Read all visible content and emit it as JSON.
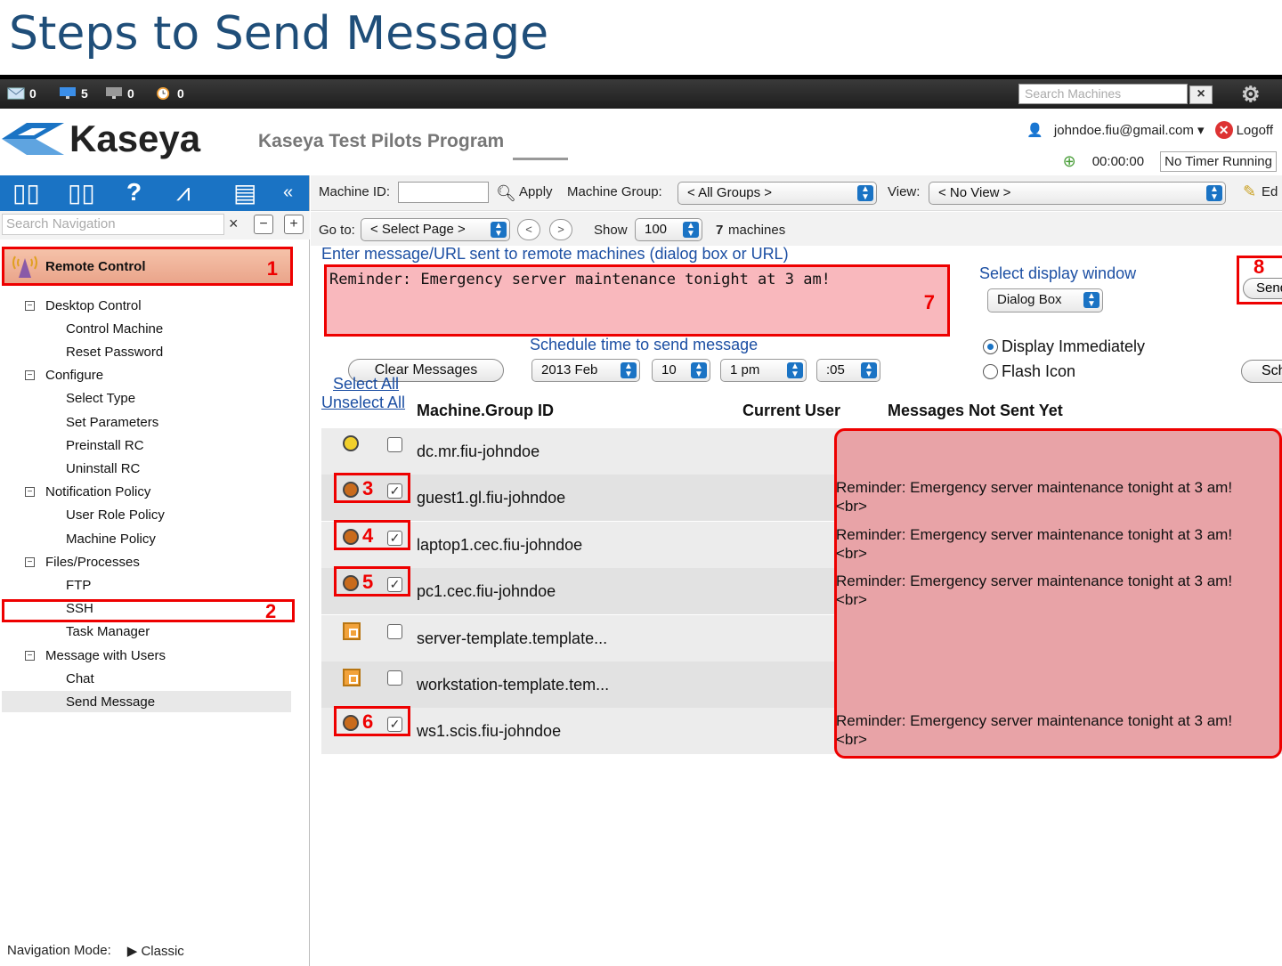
{
  "slide_title": "Steps to Send Message",
  "topbar": {
    "counts": [
      "0",
      "5",
      "0",
      "0"
    ],
    "search_placeholder": "Search Machines",
    "search_clear": "×"
  },
  "header": {
    "logo": "Kaseya",
    "program": "Kaseya Test Pilots Program",
    "user": "johndoe.fiu@gmail.com ▾",
    "logoff": "Logoff",
    "timer": "00:00:00",
    "timer_status": "No Timer Running"
  },
  "nav": {
    "search_placeholder": "Search Navigation",
    "search_clear": "×",
    "collapse": "−",
    "expand": "+",
    "module": "Remote Control",
    "tree": [
      {
        "type": "folder",
        "label": "Desktop Control"
      },
      {
        "type": "leaf",
        "label": "Control Machine"
      },
      {
        "type": "leaf",
        "label": "Reset Password"
      },
      {
        "type": "folder",
        "label": "Configure"
      },
      {
        "type": "leaf",
        "label": "Select Type"
      },
      {
        "type": "leaf",
        "label": "Set Parameters"
      },
      {
        "type": "leaf",
        "label": "Preinstall RC"
      },
      {
        "type": "leaf",
        "label": "Uninstall RC"
      },
      {
        "type": "folder",
        "label": "Notification Policy"
      },
      {
        "type": "leaf",
        "label": "User Role Policy"
      },
      {
        "type": "leaf",
        "label": "Machine Policy"
      },
      {
        "type": "folder",
        "label": "Files/Processes"
      },
      {
        "type": "leaf",
        "label": "FTP"
      },
      {
        "type": "leaf",
        "label": "SSH"
      },
      {
        "type": "leaf",
        "label": "Task Manager"
      },
      {
        "type": "folder",
        "label": "Message with Users"
      },
      {
        "type": "leaf",
        "label": "Chat"
      },
      {
        "type": "leaf",
        "label": "Send Message"
      }
    ],
    "footer_label": "Navigation Mode:",
    "footer_mode": "Classic"
  },
  "callouts": [
    "1",
    "2",
    "3",
    "4",
    "5",
    "6",
    "7",
    "8"
  ],
  "filter": {
    "machine_id_label": "Machine ID:",
    "apply": "Apply",
    "group_label": "Machine Group:",
    "group_value": "< All Groups >",
    "view_label": "View:",
    "view_value": "< No View >",
    "edit": "Ed"
  },
  "paging": {
    "goto_label": "Go to:",
    "page_value": "< Select Page >",
    "prev": "<",
    "next": ">",
    "show_label": "Show",
    "show_value": "100",
    "count_num": "7",
    "count_text": "machines"
  },
  "message": {
    "label": "Enter message/URL sent to remote machines (dialog box or URL)",
    "text": "Reminder: Emergency server maintenance tonight at 3 am!",
    "display_label": "Select display window",
    "display_value": "Dialog Box",
    "send_button": "Send",
    "schedule_label": "Schedule time to send message",
    "clear_button": "Clear Messages",
    "date": "2013 Feb",
    "day": "10",
    "hour": "1 pm",
    "minute": ":05",
    "opt_immediate": "Display Immediately",
    "opt_flash": "Flash Icon",
    "schedule_button": "Schedule"
  },
  "table": {
    "select_all": "Select All",
    "unselect_all": "Unselect All",
    "col_machine": "Machine.Group ID",
    "col_user": "Current User",
    "col_notsent": "Messages Not Sent Yet",
    "rows": [
      {
        "icon": "agent-online-icon",
        "checked": "",
        "name": "dc.mr.fiu-johndoe",
        "msg": "",
        "br": ""
      },
      {
        "icon": "agent-user-icon",
        "checked": "✓",
        "name": "guest1.gl.fiu-johndoe",
        "msg": "Reminder: Emergency server maintenance tonight at 3 am!",
        "br": "<br>"
      },
      {
        "icon": "agent-user-icon",
        "checked": "✓",
        "name": "laptop1.cec.fiu-johndoe",
        "msg": "Reminder: Emergency server maintenance tonight at 3 am!",
        "br": "<br>"
      },
      {
        "icon": "agent-user-icon",
        "checked": "✓",
        "name": "pc1.cec.fiu-johndoe",
        "msg": "Reminder: Emergency server maintenance tonight at 3 am!",
        "br": "<br>"
      },
      {
        "icon": "template-icon",
        "checked": "",
        "name": "server-template.template...",
        "msg": "",
        "br": ""
      },
      {
        "icon": "template-icon",
        "checked": "",
        "name": "workstation-template.tem...",
        "msg": "",
        "br": ""
      },
      {
        "icon": "agent-user-icon",
        "checked": "✓",
        "name": "ws1.scis.fiu-johndoe",
        "msg": "Reminder: Emergency server maintenance tonight at 3 am!",
        "br": "<br>"
      }
    ]
  },
  "colors": {
    "accent": "#1a73c4",
    "highlight": "#e00000",
    "title": "#1f4e79"
  }
}
